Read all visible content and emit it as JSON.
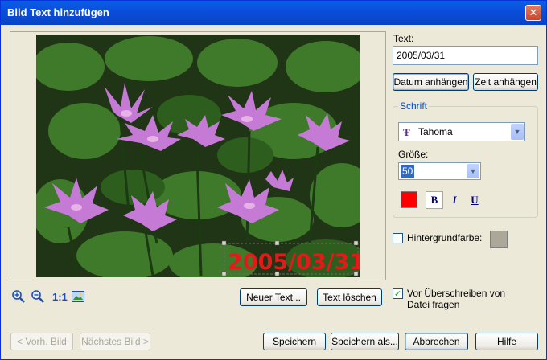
{
  "window": {
    "title": "Bild Text hinzufügen",
    "close_glyph": "✕"
  },
  "preview": {
    "overlay_text": "2005/03/31",
    "overlay_color": "#E41A1A",
    "zoom_label": "1:1"
  },
  "buttons": {
    "new_text": "Neuer Text...",
    "delete_text": "Text löschen",
    "prev_image": "< Vorh. Bild",
    "next_image": "Nächstes Bild >",
    "save": "Speichern",
    "save_as": "Speichern als...",
    "cancel": "Abbrechen",
    "help": "Hilfe"
  },
  "text_panel": {
    "label": "Text:",
    "value": "2005/03/31",
    "append_date": "Datum anhängen",
    "append_time": "Zeit anhängen"
  },
  "font_group": {
    "legend": "Schrift",
    "font_name": "Tahoma",
    "size_label": "Größe:",
    "size_value": "50",
    "color": "#FF0000",
    "bold_label": "B",
    "italic_label": "I",
    "underline_label": "U"
  },
  "background": {
    "label": "Hintergrundfarbe:",
    "checked": false,
    "color": "#ACA899"
  },
  "overwrite": {
    "label_line1": "Vor Überschreiben von",
    "label_line2": "Datei fragen",
    "checked": true,
    "check_glyph": "✓"
  },
  "icons": {
    "zoom_in": "zoom-in-icon",
    "zoom_out": "zoom-out-icon",
    "fit": "fit-to-window-icon",
    "font_type": "truetype-font-icon"
  }
}
